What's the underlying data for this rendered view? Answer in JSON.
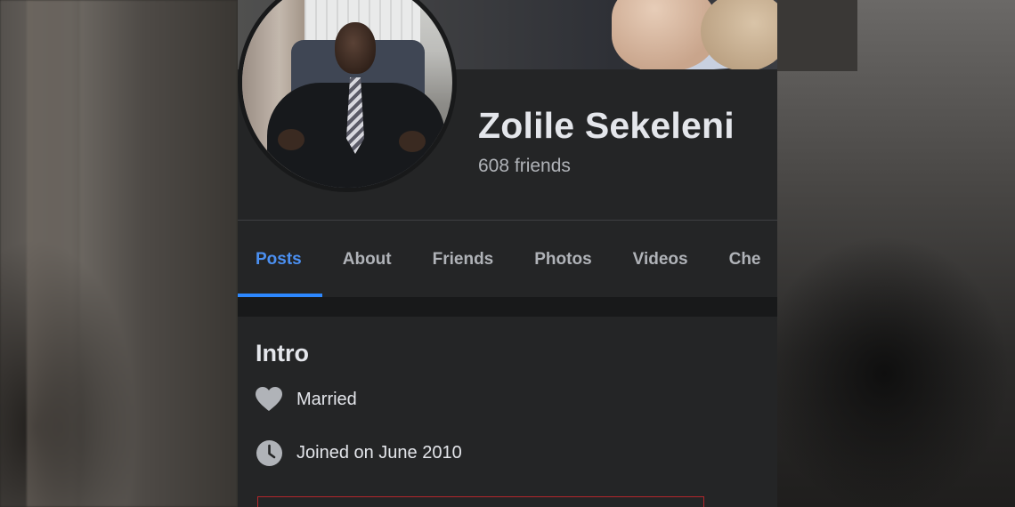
{
  "profile": {
    "name": "Zolile Sekeleni",
    "friends": "608 friends"
  },
  "tabs": [
    {
      "label": "Posts",
      "active": true
    },
    {
      "label": "About",
      "active": false
    },
    {
      "label": "Friends",
      "active": false
    },
    {
      "label": "Photos",
      "active": false
    },
    {
      "label": "Videos",
      "active": false
    },
    {
      "label": "Che",
      "active": false
    }
  ],
  "intro": {
    "title": "Intro",
    "items": [
      {
        "icon": "heart-icon",
        "text": "Married"
      },
      {
        "icon": "clock-icon",
        "text": "Joined on June 2010"
      }
    ]
  },
  "colors": {
    "background": "#242526",
    "accent": "#2d88ff",
    "text_primary": "#e4e6eb",
    "text_secondary": "#b0b3b8",
    "highlight_box": "#b3262c"
  }
}
